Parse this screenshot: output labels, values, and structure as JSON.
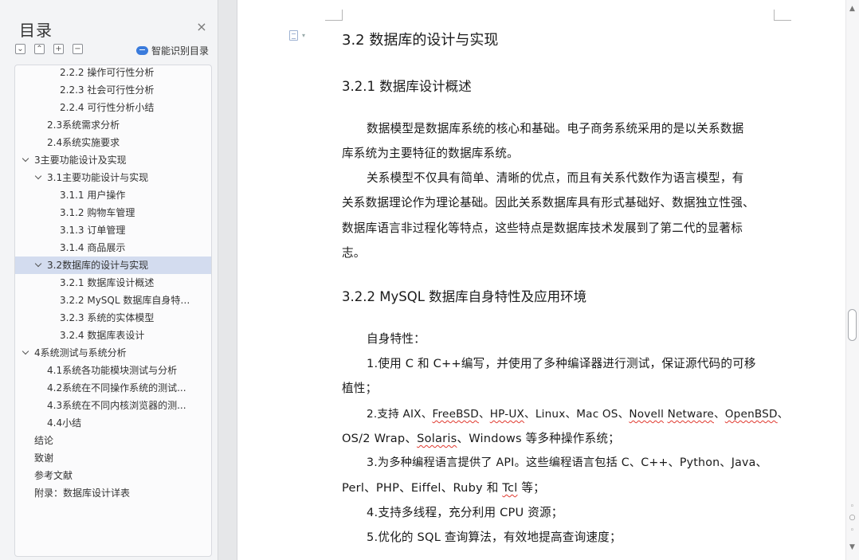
{
  "sidebar": {
    "title": "目录",
    "close_symbol": "×",
    "tools": {
      "expand": "⌄",
      "collapse": "⌃",
      "add": "+",
      "remove": "−"
    },
    "smart_label": "智能识别目录",
    "toc": [
      {
        "label": "2.2.2  操作可行性分析",
        "level": 3
      },
      {
        "label": "2.2.3  社会可行性分析",
        "level": 3
      },
      {
        "label": "2.2.4 可行性分析小结",
        "level": 3
      },
      {
        "label": "2.3系统需求分析",
        "level": 2
      },
      {
        "label": "2.4系统实施要求",
        "level": 2
      },
      {
        "label": "3主要功能设计及实现",
        "level": 1,
        "expanded": true
      },
      {
        "label": "3.1主要功能设计与实现",
        "level": 2,
        "expanded": true
      },
      {
        "label": "3.1.1  用户操作",
        "level": 3
      },
      {
        "label": "3.1.2 购物车管理",
        "level": 3
      },
      {
        "label": "3.1.3 订单管理",
        "level": 3
      },
      {
        "label": "3.1.4 商品展示",
        "level": 3
      },
      {
        "label": "3.2数据库的设计与实现",
        "level": 2,
        "expanded": true,
        "active": true
      },
      {
        "label": "3.2.1 数据库设计概述",
        "level": 3
      },
      {
        "label": "3.2.2 MySQL 数据库自身特性...",
        "level": 3
      },
      {
        "label": "3.2.3  系统的实体模型",
        "level": 3
      },
      {
        "label": "3.2.4 数据库表设计",
        "level": 3
      },
      {
        "label": "4系统测试与系统分析",
        "level": 1,
        "expanded": true
      },
      {
        "label": "4.1系统各功能模块测试与分析",
        "level": 2
      },
      {
        "label": "4.2系统在不同操作系统的测试...",
        "level": 2
      },
      {
        "label": "4.3系统在不同内核浏览器的测...",
        "level": 2
      },
      {
        "label": "4.4小结",
        "level": 2
      },
      {
        "label": "结论",
        "level": 1
      },
      {
        "label": "致谢",
        "level": 1
      },
      {
        "label": "参考文献",
        "level": 1
      },
      {
        "label": "附录：数据库设计详表",
        "level": 1
      }
    ]
  },
  "document": {
    "h2": "3.2  数据库的设计与实现",
    "h3a": "3.2.1 数据库设计概述",
    "p1a": "数据模型是数据库系统的核心和基础。电子商务系统采用的是以关系数据",
    "p1b": "库系统为主要特征的数据库系统。",
    "p2a": "关系模型不仅具有简单、清晰的优点，而且有关系代数作为语言模型，有",
    "p2b": "关系数据理论作为理论基础。因此关系数据库具有形式基础好、数据独立性强、",
    "p2c": "数据库语言非过程化等特点，这些特点是数据库技术发展到了第二代的显著标",
    "p2d": "志。",
    "h3b": "3.2.2 MySQL 数据库自身特性及应用环境",
    "feat": "自身特性：",
    "l1a": "1.使用 C 和 C++编写，并使用了多种编译器进行测试，保证源代码的可移",
    "l1b": "植性；",
    "l2a_pre": "2.支持 AIX、",
    "l2a_w1": "FreeBSD",
    "l2a_s1": "、",
    "l2a_w2": "HP-UX",
    "l2a_s2": "、Linux、Mac OS、",
    "l2a_w3": "Novell",
    "l2a_s3": " ",
    "l2a_w4": "Netware",
    "l2a_s4": "、",
    "l2a_w5": "OpenBSD",
    "l2a_s5": "、",
    "l2b_pre": "OS/2 Wrap、",
    "l2b_w1": "Solaris",
    "l2b_post": "、Windows 等多种操作系统；",
    "l3a": "3.为多种编程语言提供了 API。这些编程语言包括 C、C++、Python、Java、",
    "l3b_pre": "Perl、PHP、Eiffel、Ruby 和 ",
    "l3b_w": "Tcl",
    "l3b_post": " 等；",
    "l4": "4.支持多线程，充分利用 CPU 资源；",
    "l5": "5.优化的 SQL 查询算法，有效地提高查询速度；"
  },
  "scrollbar": {
    "up": "▲",
    "prev": "◦",
    "next": "◦",
    "down": "▼"
  }
}
